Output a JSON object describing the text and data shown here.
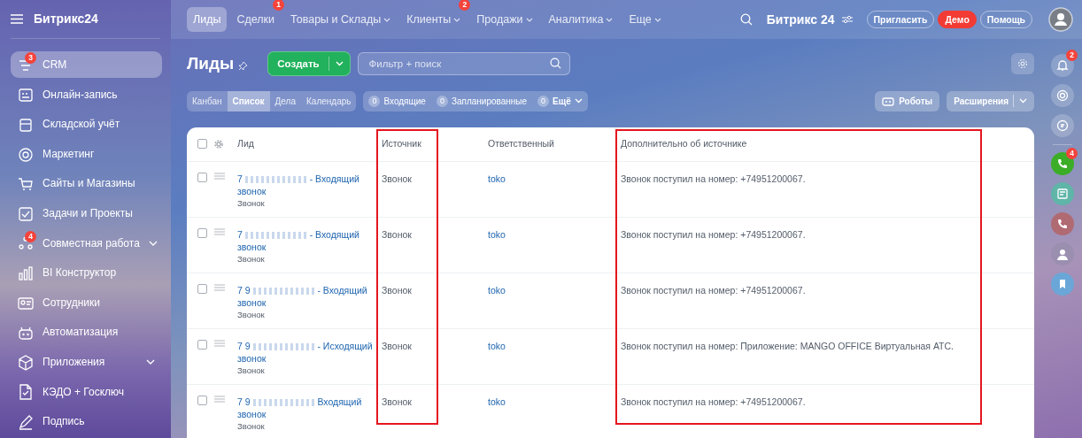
{
  "sidebar": {
    "brand": "Битрикс24",
    "items": [
      {
        "label": "CRM",
        "selected": true,
        "badge": "3",
        "expandable": false
      },
      {
        "label": "Онлайн-запись",
        "selected": false,
        "expandable": false
      },
      {
        "label": "Складской учёт",
        "selected": false,
        "expandable": false
      },
      {
        "label": "Маркетинг",
        "selected": false,
        "expandable": false
      },
      {
        "label": "Сайты и Магазины",
        "selected": false,
        "expandable": false
      },
      {
        "label": "Задачи и Проекты",
        "selected": false,
        "expandable": false
      },
      {
        "label": "Совместная работа",
        "selected": false,
        "badge": "4",
        "expandable": true
      },
      {
        "label": "BI Конструктор",
        "selected": false,
        "expandable": false
      },
      {
        "label": "Сотрудники",
        "selected": false,
        "expandable": false
      },
      {
        "label": "Автоматизация",
        "selected": false,
        "expandable": false
      },
      {
        "label": "Приложения",
        "selected": false,
        "expandable": true
      },
      {
        "label": "КЭДО + Госключ",
        "selected": false,
        "expandable": false
      },
      {
        "label": "Подпись",
        "selected": false,
        "expandable": false
      }
    ]
  },
  "top_nav": {
    "tabs": [
      {
        "label": "Лиды",
        "selected": true,
        "dropdown": false
      },
      {
        "label": "Сделки",
        "selected": false,
        "dropdown": false,
        "badge": "1"
      },
      {
        "label": "Товары и Склады",
        "selected": false,
        "dropdown": true
      },
      {
        "label": "Клиенты",
        "selected": false,
        "dropdown": true,
        "badge": "2"
      },
      {
        "label": "Продажи",
        "selected": false,
        "dropdown": true
      },
      {
        "label": "Аналитика",
        "selected": false,
        "dropdown": true
      },
      {
        "label": "Еще",
        "selected": false,
        "dropdown": true
      }
    ],
    "logo": "Битрикс 24",
    "buttons": [
      {
        "label": "Пригласить",
        "kind": "outline"
      },
      {
        "label": "Демо",
        "kind": "danger"
      },
      {
        "label": "Помощь",
        "kind": "outline"
      }
    ]
  },
  "toolbar": {
    "title": "Лиды",
    "create_button": "Создать",
    "search": {
      "placeholder": "Фильтр + поиск"
    }
  },
  "views": [
    {
      "label": "Канбан",
      "selected": false
    },
    {
      "label": "Список",
      "selected": true
    },
    {
      "label": "Дела",
      "selected": false
    },
    {
      "label": "Календарь",
      "selected": false
    }
  ],
  "counters": [
    {
      "count": "0",
      "label": "Входящие",
      "dropdown": false
    },
    {
      "count": "0",
      "label": "Запланированные",
      "dropdown": false
    },
    {
      "count": "0",
      "label": "Ещё",
      "dropdown": true
    }
  ],
  "actions": [
    {
      "label": "Роботы",
      "kind": "robots"
    },
    {
      "label": "Расширения",
      "kind": "split"
    }
  ],
  "right_rail": {
    "notification_badge": "2",
    "call_badge": "4"
  },
  "table": {
    "select_all_checked": false,
    "columns": [
      {
        "label": "Лид",
        "highlighted": false
      },
      {
        "label": "Источник",
        "highlighted": true
      },
      {
        "label": "Ответственный",
        "highlighted": false
      },
      {
        "label": "Дополнительно об источнике",
        "highlighted": true
      }
    ],
    "rows": [
      {
        "checked": false,
        "lead_prefix": "7",
        "lead_title": "- Входящий звонок",
        "lead_type": "Звонок",
        "source": "Звонок",
        "responsible": "toko",
        "source_info": "Звонок поступил на номер: +74951200067."
      },
      {
        "checked": false,
        "lead_prefix": "7",
        "lead_title": "- Входящий звонок",
        "lead_type": "Звонок",
        "source": "Звонок",
        "responsible": "toko",
        "source_info": "Звонок поступил на номер: +74951200067."
      },
      {
        "checked": false,
        "lead_prefix": "7 9",
        "lead_title": "- Входящий звонок",
        "lead_type": "Звонок",
        "source": "Звонок",
        "responsible": "toko",
        "source_info": "Звонок поступил на номер: +74951200067."
      },
      {
        "checked": false,
        "lead_prefix": "7 9",
        "lead_title": "- Исходящий звонок",
        "lead_type": "Звонок",
        "source": "Звонок",
        "responsible": "toko",
        "source_info": "Звонок поступил на номер: Приложение: MANGO OFFICE Виртуальная АТС."
      },
      {
        "checked": false,
        "lead_prefix": "7 9",
        "lead_title": "Входящий звонок",
        "lead_type": "Звонок",
        "source": "Звонок",
        "responsible": "toko",
        "source_info": "Звонок поступил на номер: +74951200067."
      }
    ]
  }
}
